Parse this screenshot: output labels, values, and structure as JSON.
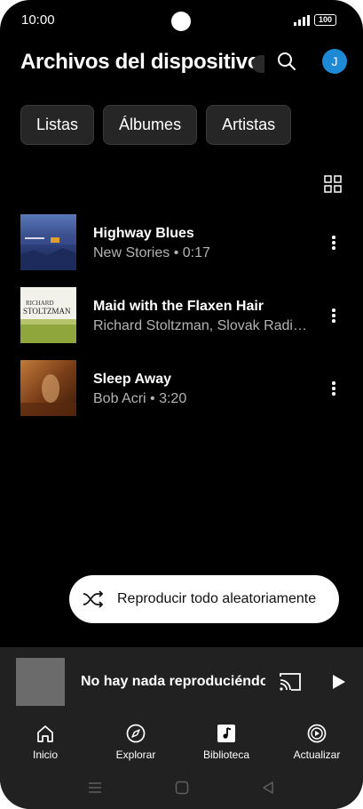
{
  "status": {
    "time": "10:00",
    "battery": "100"
  },
  "header": {
    "title": "Archivos del dispositivo",
    "avatar_letter": "J"
  },
  "chips": [
    "Listas",
    "Álbumes",
    "Artistas"
  ],
  "songs": [
    {
      "title": "Highway Blues",
      "subtitle": "New Stories • 0:17"
    },
    {
      "title": "Maid with the Flaxen Hair",
      "subtitle": "Richard Stoltzman, Slovak Radio Symphony Orchestra"
    },
    {
      "title": "Sleep Away",
      "subtitle": "Bob Acri • 3:20"
    }
  ],
  "album_art_text": {
    "maid_line1": "RICHARD",
    "maid_line2": "STOLTZMAN"
  },
  "shuffle": {
    "label": "Reproducir todo aleatoriamente"
  },
  "mini_player": {
    "title": "No hay nada reproduciéndose"
  },
  "bottom_nav": [
    {
      "label": "Inicio",
      "icon": "home-icon"
    },
    {
      "label": "Explorar",
      "icon": "compass-icon"
    },
    {
      "label": "Biblioteca",
      "icon": "library-icon"
    },
    {
      "label": "Actualizar",
      "icon": "upgrade-icon"
    }
  ],
  "colors": {
    "background": "#000000",
    "surface": "#212121",
    "chip": "#262626",
    "avatar": "#1e8ad6",
    "secondary_text": "#b3b3b3"
  }
}
